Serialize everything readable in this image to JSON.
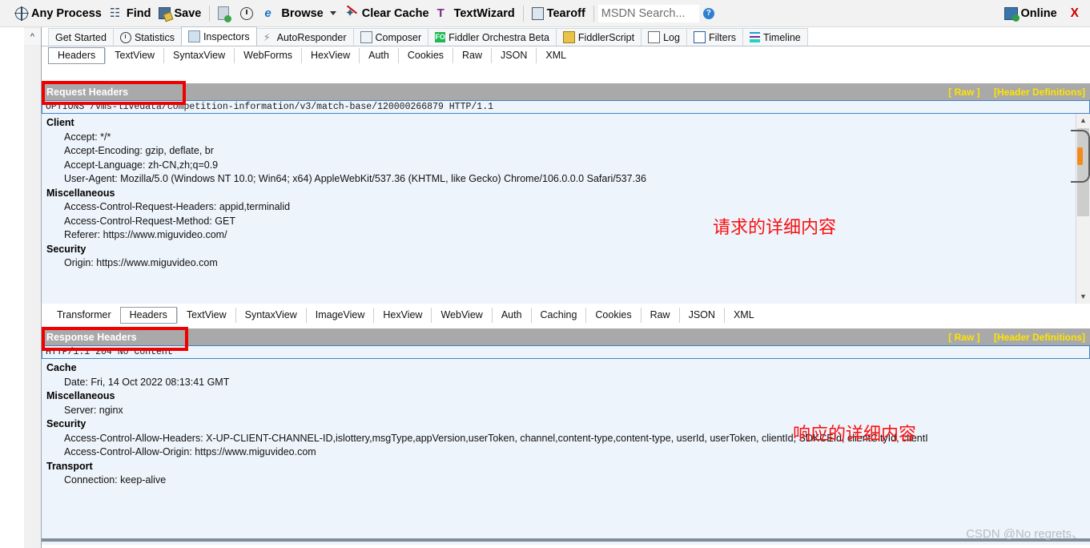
{
  "toolbar": {
    "items": [
      {
        "label": "Any Process",
        "icon": "target-icon"
      },
      {
        "label": "Find",
        "icon": "binoculars-icon"
      },
      {
        "label": "Save",
        "icon": "save-disk-icon"
      },
      {
        "label": "",
        "icon": "clipboard-icon"
      },
      {
        "label": "",
        "icon": "stopwatch-icon"
      },
      {
        "label": "Browse",
        "icon": "internet-explorer-icon"
      },
      {
        "label": "Clear Cache",
        "icon": "clear-cache-icon"
      },
      {
        "label": "TextWizard",
        "icon": "text-wizard-icon"
      },
      {
        "label": "Tearoff",
        "icon": "tearoff-icon"
      }
    ],
    "msdn_search_placeholder": "MSDN Search...",
    "help_icon": "help-icon",
    "online_label": "Online",
    "close_label": "X"
  },
  "main_tabs": [
    {
      "label": "Get Started",
      "icon": "",
      "selected": false
    },
    {
      "label": "Statistics",
      "icon": "stopwatch-icon",
      "selected": false
    },
    {
      "label": "Inspectors",
      "icon": "inspectors-icon",
      "selected": true
    },
    {
      "label": "AutoResponder",
      "icon": "bolt-icon",
      "selected": false
    },
    {
      "label": "Composer",
      "icon": "composer-icon",
      "selected": false
    },
    {
      "label": "Fiddler Orchestra Beta",
      "icon": "fo-icon",
      "selected": false
    },
    {
      "label": "FiddlerScript",
      "icon": "fiddlerscript-icon",
      "selected": false
    },
    {
      "label": "Log",
      "icon": "log-icon",
      "selected": false
    },
    {
      "label": "Filters",
      "icon": "filters-icon",
      "selected": false
    },
    {
      "label": "Timeline",
      "icon": "timeline-icon",
      "selected": false
    }
  ],
  "request_tabs": [
    {
      "label": "Headers",
      "selected": true
    },
    {
      "label": "TextView",
      "selected": false
    },
    {
      "label": "SyntaxView",
      "selected": false
    },
    {
      "label": "WebForms",
      "selected": false
    },
    {
      "label": "HexView",
      "selected": false
    },
    {
      "label": "Auth",
      "selected": false
    },
    {
      "label": "Cookies",
      "selected": false
    },
    {
      "label": "Raw",
      "selected": false
    },
    {
      "label": "JSON",
      "selected": false
    },
    {
      "label": "XML",
      "selected": false
    }
  ],
  "response_tabs": [
    {
      "label": "Transformer",
      "selected": false
    },
    {
      "label": "Headers",
      "selected": true
    },
    {
      "label": "TextView",
      "selected": false
    },
    {
      "label": "SyntaxView",
      "selected": false
    },
    {
      "label": "ImageView",
      "selected": false
    },
    {
      "label": "HexView",
      "selected": false
    },
    {
      "label": "WebView",
      "selected": false
    },
    {
      "label": "Auth",
      "selected": false
    },
    {
      "label": "Caching",
      "selected": false
    },
    {
      "label": "Cookies",
      "selected": false
    },
    {
      "label": "Raw",
      "selected": false
    },
    {
      "label": "JSON",
      "selected": false
    },
    {
      "label": "XML",
      "selected": false
    }
  ],
  "request_panel": {
    "title": "Request Headers",
    "raw_link": "[ Raw ]",
    "header_definitions_link": "[Header Definitions]",
    "request_line": "OPTIONS /vms-livedata/competition-information/v3/match-base/120000266879 HTTP/1.1",
    "groups": [
      {
        "name": "Client",
        "headers": [
          "Accept: */*",
          "Accept-Encoding: gzip, deflate, br",
          "Accept-Language: zh-CN,zh;q=0.9",
          "User-Agent: Mozilla/5.0 (Windows NT 10.0; Win64; x64) AppleWebKit/537.36 (KHTML, like Gecko) Chrome/106.0.0.0 Safari/537.36"
        ]
      },
      {
        "name": "Miscellaneous",
        "headers": [
          "Access-Control-Request-Headers: appid,terminalid",
          "Access-Control-Request-Method: GET",
          "Referer: https://www.miguvideo.com/"
        ]
      },
      {
        "name": "Security",
        "headers": [
          "Origin: https://www.miguvideo.com"
        ]
      }
    ]
  },
  "response_panel": {
    "title": "Response Headers",
    "raw_link": "[ Raw ]",
    "header_definitions_link": "[Header Definitions]",
    "status_line": "HTTP/1.1 204 No Content",
    "groups": [
      {
        "name": "Cache",
        "headers": [
          "Date: Fri, 14 Oct 2022 08:13:41 GMT"
        ]
      },
      {
        "name": "Miscellaneous",
        "headers": [
          "Server: nginx"
        ]
      },
      {
        "name": "Security",
        "headers": [
          "Access-Control-Allow-Headers: X-UP-CLIENT-CHANNEL-ID,islottery,msgType,appVersion,userToken, channel,content-type,content-type, userId, userToken, clientId, SDKCEId, clientCityId, clientI",
          "Access-Control-Allow-Origin: https://www.miguvideo.com"
        ]
      },
      {
        "name": "Transport",
        "headers": [
          "Connection: keep-alive"
        ]
      }
    ]
  },
  "annotations": {
    "request_note": "请求的详细内容",
    "response_note": "响应的详细内容",
    "watermark": "CSDN @No regrets、"
  },
  "colors": {
    "annotation_red": "#fa1010",
    "panel_bar": "#a9a9a9",
    "link_yellow": "#ffe400",
    "panel_body": "#eef4fb"
  }
}
